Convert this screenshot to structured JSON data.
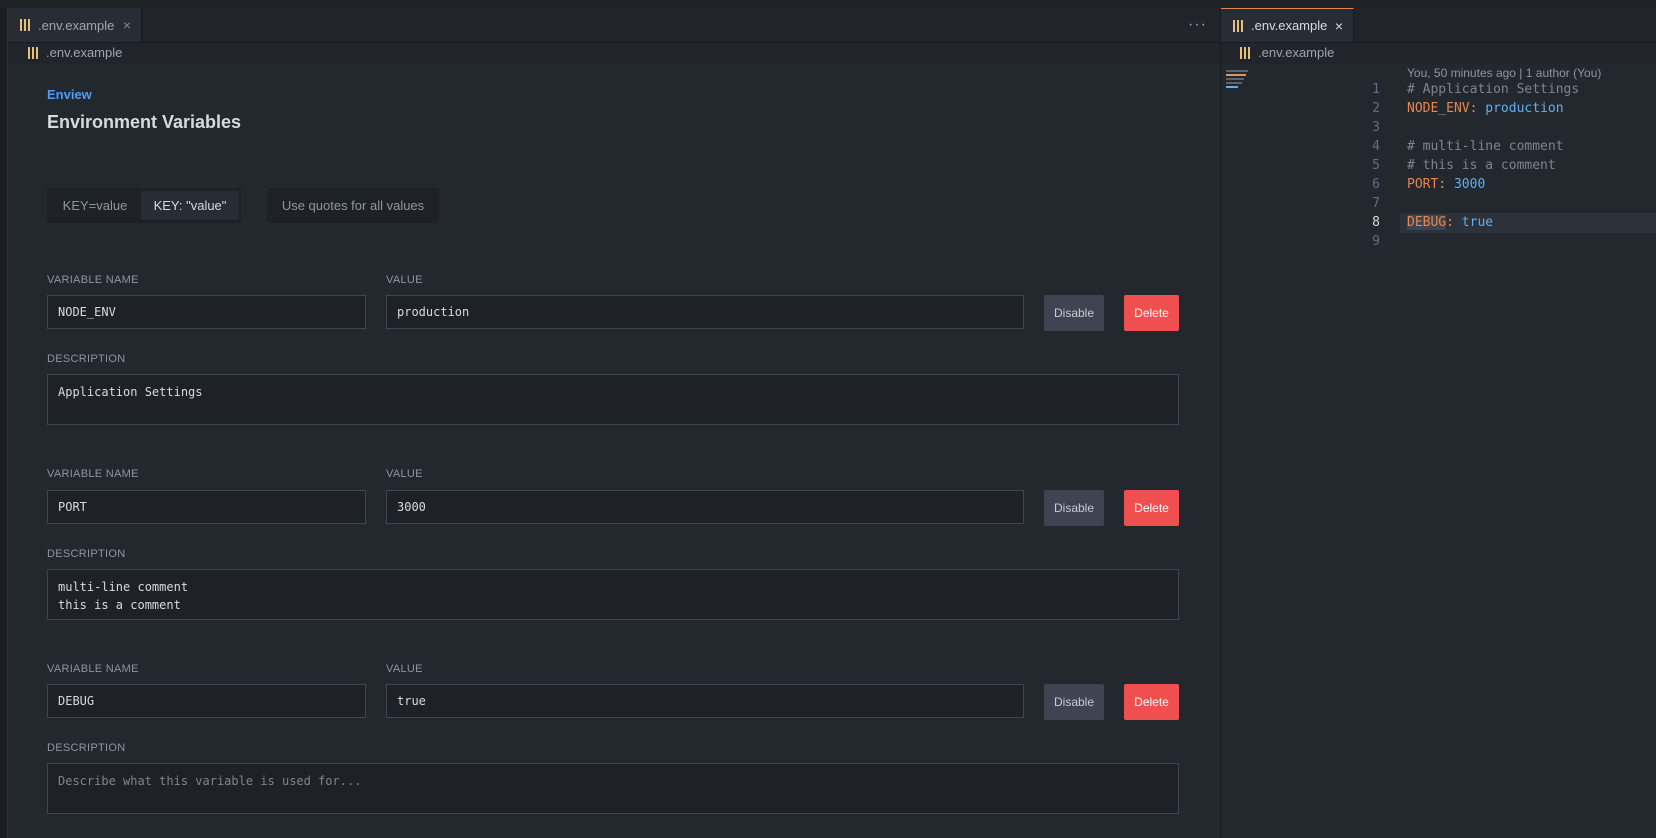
{
  "tabs": {
    "left": {
      "label": ".env.example",
      "close": "×"
    },
    "right": {
      "label": ".env.example",
      "close": "×"
    },
    "more": "···"
  },
  "breadcrumbs": {
    "left": ".env.example",
    "right": ".env.example"
  },
  "app": {
    "brand": "Enview",
    "title": "Environment Variables"
  },
  "format": {
    "options": [
      "KEY=value",
      "KEY: \"value\""
    ],
    "selected": "KEY: \"value\"",
    "quotes_label": "Use quotes for all values"
  },
  "labels": {
    "name": "VARIABLE NAME",
    "value": "VALUE",
    "description": "DESCRIPTION",
    "disable": "Disable",
    "delete": "Delete"
  },
  "variables": [
    {
      "name": "NODE_ENV",
      "value": "production",
      "description": "Application Settings"
    },
    {
      "name": "PORT",
      "value": "3000",
      "description": "multi-line comment\nthis is a comment"
    },
    {
      "name": "DEBUG",
      "value": "true",
      "description": "",
      "description_placeholder": "Describe what this variable is used for..."
    }
  ],
  "editor": {
    "blame": "You, 50 minutes ago | 1 author (You)",
    "active_line": 8,
    "lines": [
      {
        "n": "1",
        "comment": "# Application Settings"
      },
      {
        "n": "2",
        "key": "NODE_ENV",
        "sep": ": ",
        "value": "production"
      },
      {
        "n": "3"
      },
      {
        "n": "4",
        "comment": "# multi-line comment"
      },
      {
        "n": "5",
        "comment": "# this is a comment"
      },
      {
        "n": "6",
        "key": "PORT",
        "sep": ": ",
        "value": "3000"
      },
      {
        "n": "7"
      },
      {
        "n": "8",
        "key": "DEBUG",
        "sep": ": ",
        "value": "true"
      },
      {
        "n": "9"
      }
    ]
  },
  "colors": {
    "accent": "#4d9cf6",
    "delete": "#ef4f4f",
    "env_icon": "#e5c07b",
    "key": "#e5874f",
    "value": "#61afef"
  },
  "icons": [
    "env-file-icon",
    "close-icon",
    "more-actions-icon"
  ]
}
